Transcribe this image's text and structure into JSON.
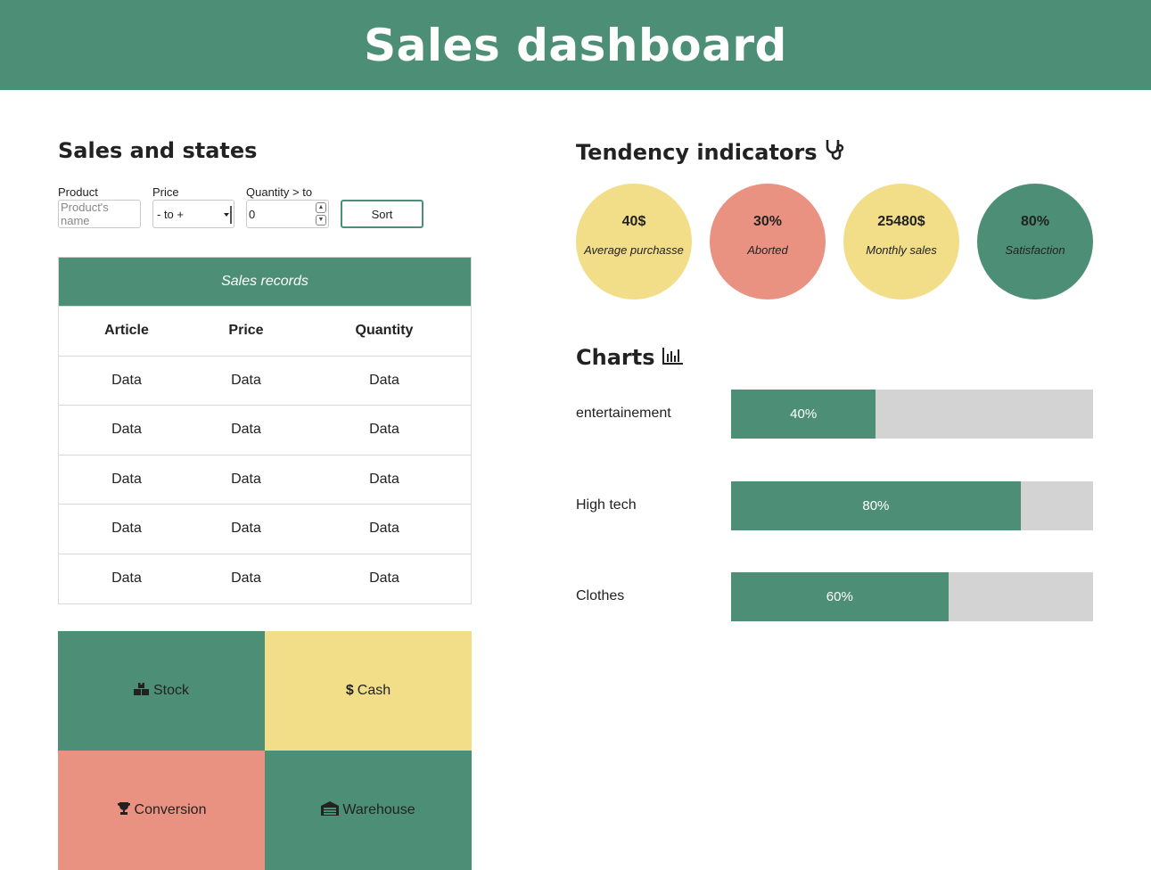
{
  "header": {
    "title": "Sales dashboard"
  },
  "sales": {
    "title": "Sales and states",
    "filters": {
      "product_label": "Product",
      "product_placeholder": "Product's name",
      "price_label": "Price",
      "price_value": "- to +",
      "quantity_label": "Quantity > to",
      "quantity_value": "0",
      "sort_label": "Sort"
    },
    "table": {
      "caption": "Sales records",
      "headers": [
        "Article",
        "Price",
        "Quantity"
      ],
      "rows": [
        [
          "Data",
          "Data",
          "Data"
        ],
        [
          "Data",
          "Data",
          "Data"
        ],
        [
          "Data",
          "Data",
          "Data"
        ],
        [
          "Data",
          "Data",
          "Data"
        ],
        [
          "Data",
          "Data",
          "Data"
        ]
      ]
    },
    "tiles": [
      {
        "label": "Stock",
        "icon": "boxes-icon",
        "color": "#4d8f76"
      },
      {
        "label": "Cash",
        "icon": "dollar-icon",
        "color": "#f2de89"
      },
      {
        "label": "Conversion",
        "icon": "trophy-icon",
        "color": "#ea9282"
      },
      {
        "label": "Warehouse",
        "icon": "warehouse-icon",
        "color": "#4d8f76"
      }
    ]
  },
  "indicators": {
    "title": "Tendency indicators",
    "icon": "stethoscope-icon",
    "items": [
      {
        "value": "40$",
        "label": "Average purchasse",
        "color": "#f2de89"
      },
      {
        "value": "30%",
        "label": "Aborted",
        "color": "#ea9282"
      },
      {
        "value": "25480$",
        "label": "Monthly sales",
        "color": "#f2de89"
      },
      {
        "value": "80%",
        "label": "Satisfaction",
        "color": "#4d8f76"
      }
    ]
  },
  "charts": {
    "title": "Charts",
    "icon": "bar-chart-icon",
    "bars": [
      {
        "label": "entertainement",
        "percent": 40,
        "text": "40%"
      },
      {
        "label": "High tech",
        "percent": 80,
        "text": "80%"
      },
      {
        "label": "Clothes",
        "percent": 60,
        "text": "60%"
      }
    ]
  },
  "colors": {
    "primary": "#4d8f76",
    "yellow": "#f2de89",
    "salmon": "#ea9282",
    "track": "#d3d3d3"
  }
}
